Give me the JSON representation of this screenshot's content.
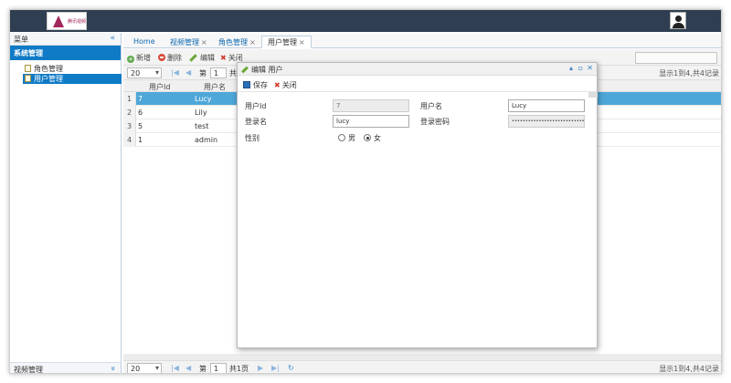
{
  "header": {
    "logo_text": "腾讯视频",
    "avatar_icon": "user-avatar-icon"
  },
  "sidebar": {
    "title": "菜单",
    "collapse_glyph": "«",
    "group": "系统管理",
    "items": [
      {
        "label": "角色管理",
        "selected": false
      },
      {
        "label": "用户管理",
        "selected": true
      }
    ],
    "footer": "视频管理",
    "footer_glyph": "»"
  },
  "tabs": [
    {
      "label": "Home",
      "closable": false,
      "active": false
    },
    {
      "label": "视频管理",
      "closable": true,
      "active": false
    },
    {
      "label": "角色管理",
      "closable": true,
      "active": false
    },
    {
      "label": "用户管理",
      "closable": true,
      "active": true
    }
  ],
  "tab_close_glyph": "×",
  "toolbar": {
    "add": "新增",
    "delete": "删除",
    "edit": "编辑",
    "close": "关闭"
  },
  "pager_top": {
    "page_size": "20",
    "page_label": "第",
    "page_value": "1",
    "total_label": "共",
    "info": "显示1到4,共4记录"
  },
  "pager_bottom": {
    "page_size": "20",
    "page_label": "第",
    "page_value": "1",
    "total_label": "共1页",
    "info": "显示1到4,共4记录"
  },
  "grid": {
    "columns": [
      "用户Id",
      "用户名"
    ],
    "rows": [
      {
        "num": "1",
        "id": "7",
        "name": "Lucy",
        "selected": true
      },
      {
        "num": "2",
        "id": "6",
        "name": "Lily",
        "selected": false
      },
      {
        "num": "3",
        "id": "5",
        "name": "test",
        "selected": false
      },
      {
        "num": "4",
        "id": "1",
        "name": "admin",
        "selected": false
      }
    ]
  },
  "dialog": {
    "title": "编辑 用户",
    "save": "保存",
    "close": "关闭",
    "fields": {
      "user_id_label": "用户Id",
      "user_id_value": "7",
      "username_label": "用户名",
      "username_value": "Lucy",
      "login_label": "登录名",
      "login_value": "lucy",
      "password_label": "登录密码",
      "password_value": "••••••••••••••••••••••••••••••••••",
      "gender_label": "性别",
      "gender_male": "男",
      "gender_female": "女",
      "gender_selected": "女"
    }
  },
  "colors": {
    "header_bg": "#2f3f51",
    "accent": "#0f7ac6",
    "row_highlight": "#4ea7d8"
  }
}
